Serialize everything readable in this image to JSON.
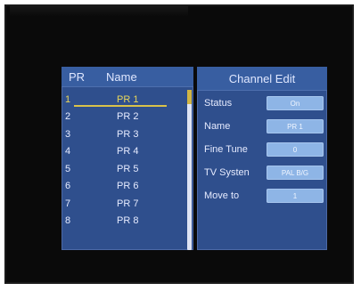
{
  "list": {
    "header_pr": "PR",
    "header_name": "Name",
    "rows": [
      {
        "num": "1",
        "name": "PR 1",
        "selected": true
      },
      {
        "num": "2",
        "name": "PR 2"
      },
      {
        "num": "3",
        "name": "PR 3"
      },
      {
        "num": "4",
        "name": "PR 4"
      },
      {
        "num": "5",
        "name": "PR 5"
      },
      {
        "num": "6",
        "name": "PR 6"
      },
      {
        "num": "7",
        "name": "PR 7"
      },
      {
        "num": "8",
        "name": "PR 8"
      }
    ]
  },
  "edit": {
    "title": "Channel Edit",
    "fields": [
      {
        "label": "Status",
        "value": "On"
      },
      {
        "label": "Name",
        "value": "PR 1"
      },
      {
        "label": "Fine Tune",
        "value": "0"
      },
      {
        "label": "TV Systen",
        "value": "PAL B/G"
      },
      {
        "label": "Move to",
        "value": "1"
      }
    ]
  },
  "colors": {
    "panel_bg": "#2f4f8d",
    "header_bg": "#385ea1",
    "selected_text": "#e8d65a",
    "value_box": "#8eb5e6"
  }
}
